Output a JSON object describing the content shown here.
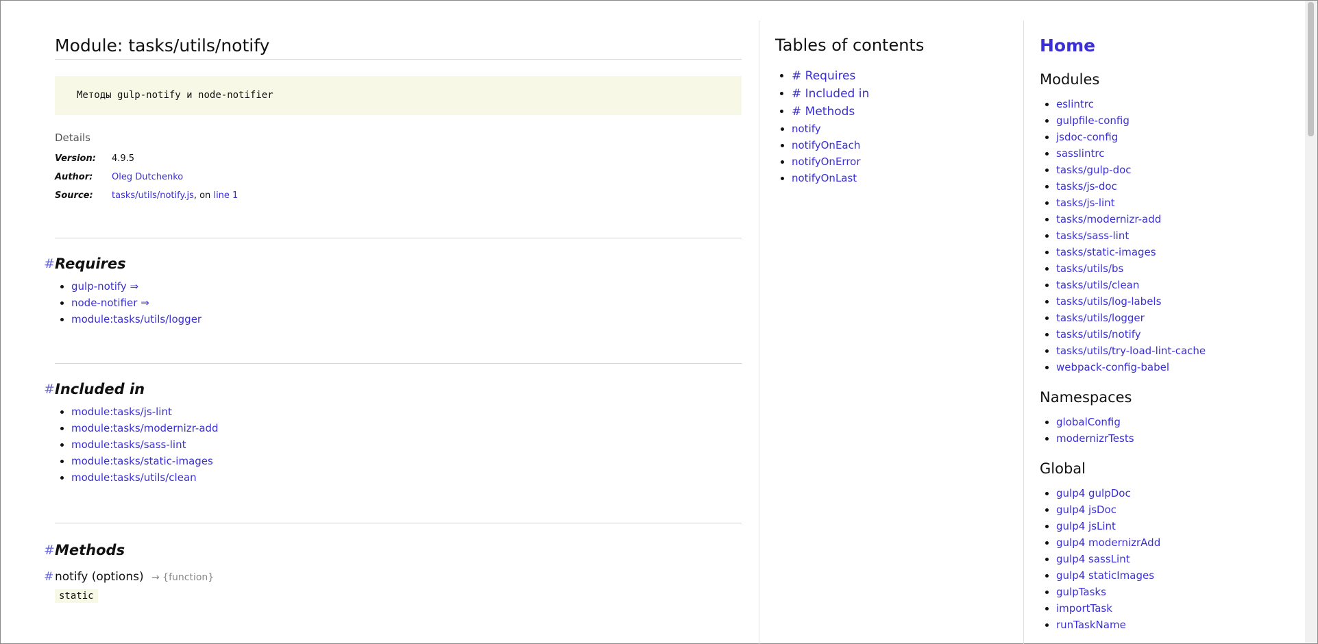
{
  "main": {
    "title": "Module: tasks/utils/notify",
    "description_prefix": "Методы",
    "description_code1": "gulp-notify",
    "description_mid": "и",
    "description_code2": "node-notifier",
    "details": {
      "header": "Details",
      "version_label": "Version:",
      "version_value": "4.9.5",
      "author_label": "Author:",
      "author_value": "Oleg Dutchenko",
      "source_label": "Source:",
      "source_file": "tasks/utils/notify.js",
      "source_mid": ", on",
      "source_line": "line 1"
    },
    "requires": {
      "hash": "#",
      "title": "Requires",
      "items": [
        "gulp-notify ⇒",
        "node-notifier ⇒",
        "module:tasks/utils/logger"
      ]
    },
    "included_in": {
      "hash": "#",
      "title": "Included in",
      "items": [
        "module:tasks/js-lint",
        "module:tasks/modernizr-add",
        "module:tasks/sass-lint",
        "module:tasks/static-images",
        "module:tasks/utils/clean"
      ]
    },
    "methods": {
      "hash": "#",
      "title": "Methods",
      "first": {
        "hash": "#",
        "name": "notify (options)",
        "returns": "→ {function}",
        "badge": "static"
      }
    }
  },
  "toc": {
    "title": "Tables of contents",
    "items": [
      "# Requires",
      "# Included in",
      "# Methods",
      "notify",
      "notifyOnEach",
      "notifyOnError",
      "notifyOnLast"
    ]
  },
  "nav": {
    "home": "Home",
    "modules_title": "Modules",
    "modules": [
      "eslintrc",
      "gulpfile-config",
      "jsdoc-config",
      "sasslintrc",
      "tasks/gulp-doc",
      "tasks/js-doc",
      "tasks/js-lint",
      "tasks/modernizr-add",
      "tasks/sass-lint",
      "tasks/static-images",
      "tasks/utils/bs",
      "tasks/utils/clean",
      "tasks/utils/log-labels",
      "tasks/utils/logger",
      "tasks/utils/notify",
      "tasks/utils/try-load-lint-cache",
      "webpack-config-babel"
    ],
    "namespaces_title": "Namespaces",
    "namespaces": [
      "globalConfig",
      "modernizrTests"
    ],
    "global_title": "Global",
    "global": [
      "gulp4 gulpDoc",
      "gulp4 jsDoc",
      "gulp4 jsLint",
      "gulp4 modernizrAdd",
      "gulp4 sassLint",
      "gulp4 staticImages",
      "gulpTasks",
      "importTask",
      "runTaskName"
    ]
  }
}
